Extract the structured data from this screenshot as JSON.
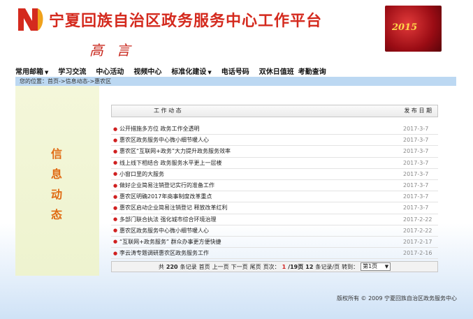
{
  "header": {
    "site_title": "宁夏回族自治区政务服务中心工作平台",
    "signature": "高 言",
    "banner_year": "2015"
  },
  "nav": [
    {
      "label": "常用邮箱",
      "dropdown": true
    },
    {
      "label": "学习交流",
      "dropdown": false
    },
    {
      "label": "中心活动",
      "dropdown": false
    },
    {
      "label": "视频中心",
      "dropdown": false
    },
    {
      "label": "标准化建设",
      "dropdown": true
    },
    {
      "label": "电话号码",
      "dropdown": false
    },
    {
      "label": "双休日值班",
      "dropdown": false
    },
    {
      "label": "考勤查询",
      "dropdown": false
    }
  ],
  "breadcrumb": "您的位置：首页->信息动态->惠农区",
  "side_title": [
    "信",
    "息",
    "动",
    "态"
  ],
  "list_header": {
    "col_title": "工 作 动 态",
    "col_date": "发 布 日 期"
  },
  "articles": [
    {
      "title": "公开措施多方位 政务工作全透明",
      "date": "2017-3-7"
    },
    {
      "title": "惠农区政务服务中心微小细节暖人心",
      "date": "2017-3-7"
    },
    {
      "title": "惠农区“互联网+政务”大力提升政务服务效率",
      "date": "2017-3-7"
    },
    {
      "title": "线上线下相结合 政务服务水平更上一层楼",
      "date": "2017-3-7"
    },
    {
      "title": "小窗口里的大服务",
      "date": "2017-3-7"
    },
    {
      "title": "做好企业简易注销登记实行的准备工作",
      "date": "2017-3-7"
    },
    {
      "title": "惠农区明确2017年商事制度改革重点",
      "date": "2017-3-7"
    },
    {
      "title": "惠农区启动企业简易注销登记 释放改革红利",
      "date": "2017-3-7"
    },
    {
      "title": "多部门联合执法 强化城市综合环境治理",
      "date": "2017-2-22"
    },
    {
      "title": "惠农区政务服务中心微小细节暖人心",
      "date": "2017-2-22"
    },
    {
      "title": "“互联网+政务服务” 群众办事更方便快捷",
      "date": "2017-2-17"
    },
    {
      "title": "李云涛专题调研惠农区政务服务工作",
      "date": "2017-2-16"
    }
  ],
  "pager": {
    "total_prefix": "共",
    "total": "220",
    "total_suffix": "条记录",
    "first": "首页",
    "prev": "上一页",
    "next": "下一页",
    "last": "尾页",
    "page_label": "页次：",
    "current_page": "1",
    "total_pages": "/19页",
    "per_page": "12",
    "per_page_suffix": "条记录/页",
    "goto_label": "转到：",
    "goto_value": "第1页"
  },
  "footer": "版权所有 © 2009 宁夏回族自治区政务服务中心",
  "colors": {
    "title_red": "#d42a1e",
    "side_title_orange": "#e06a12",
    "breadcrumb_blue": "#bcd8f2",
    "side_bg": "#f4f7da"
  }
}
